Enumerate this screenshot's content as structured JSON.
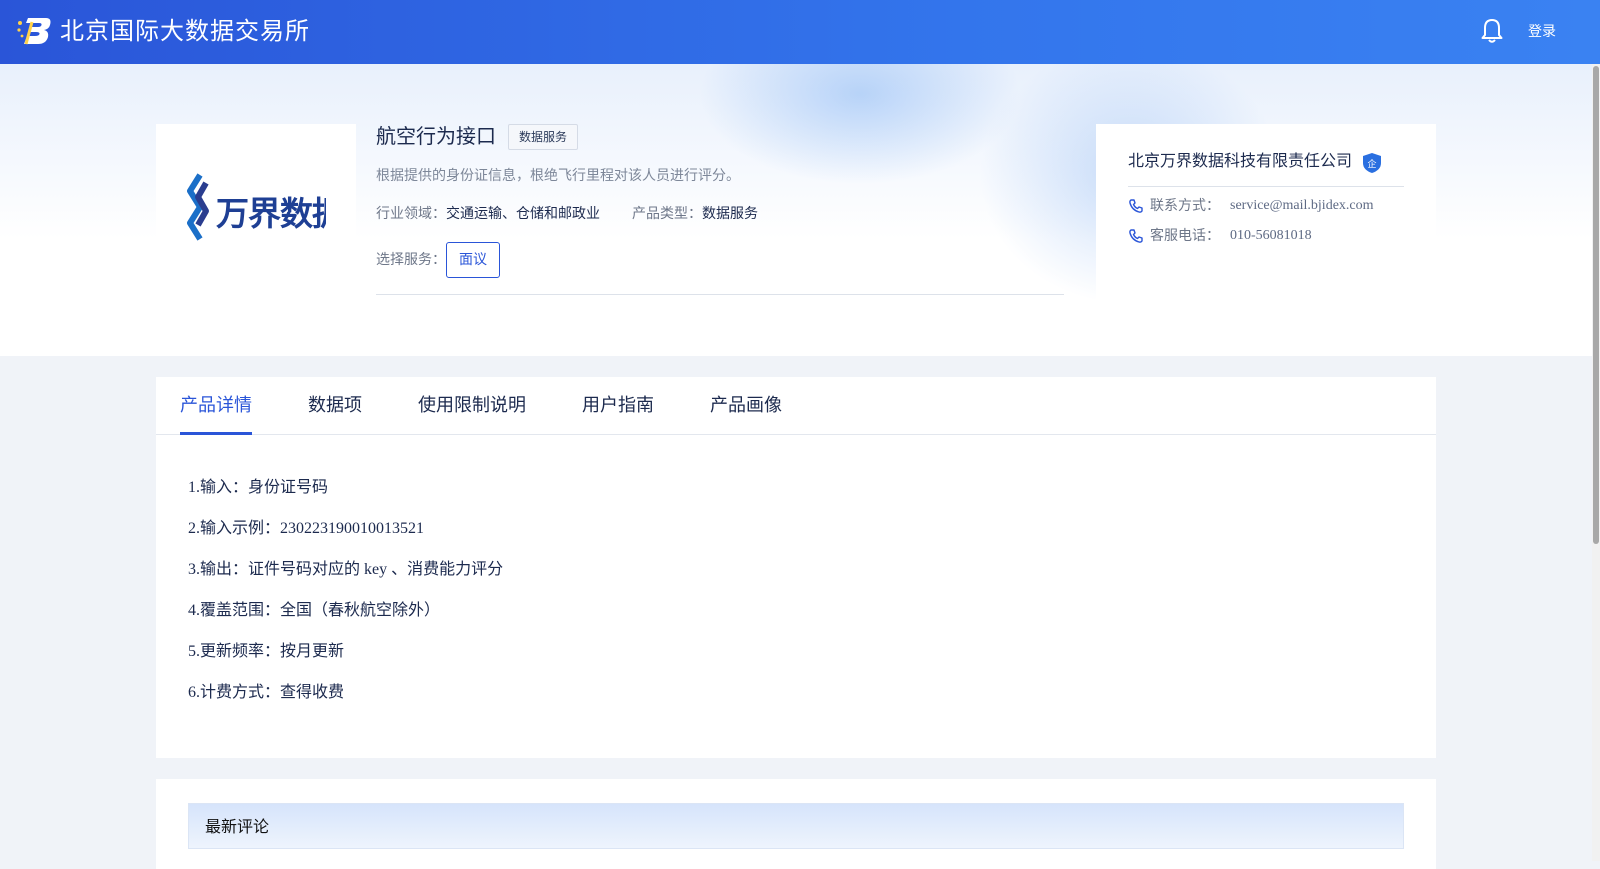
{
  "header": {
    "site_title": "北京国际大数据交易所",
    "login_label": "登录"
  },
  "product": {
    "name": "航空行为接口",
    "type_tag": "数据服务",
    "description": "根据提供的身份证信息，根绝飞行里程对该人员进行评分。",
    "industry_label": "行业领域：",
    "industry_value": "交通运输、仓储和邮政业",
    "product_type_label": "产品类型：",
    "product_type_value": "数据服务",
    "service_label": "选择服务：",
    "service_option": "面议"
  },
  "company": {
    "name": "北京万界数据科技有限责任公司",
    "badge_text": "企",
    "contact_label": "联系方式：",
    "contact_value": "service@mail.bjidex.com",
    "phone_label": "客服电话：",
    "phone_value": "010-56081018"
  },
  "tabs": [
    {
      "label": "产品详情",
      "active": true
    },
    {
      "label": "数据项",
      "active": false
    },
    {
      "label": "使用限制说明",
      "active": false
    },
    {
      "label": "用户指南",
      "active": false
    },
    {
      "label": "产品画像",
      "active": false
    }
  ],
  "details": [
    "1.输入：身份证号码",
    "2.输入示例：230223190010013521",
    "3.输出：证件号码对应的 key 、消费能力评分",
    "4.覆盖范围：全国（春秋航空除外）",
    "5.更新频率：按月更新",
    "6.计费方式：查得收费"
  ],
  "comments": {
    "title": "最新评论"
  },
  "colors": {
    "accent": "#2a55d8",
    "header_start": "#2a55d8",
    "header_end": "#3a82f2",
    "text_dark": "#1c2a4e"
  },
  "icons": {
    "logo": "bjidex-logo-icon",
    "bell": "bell-icon",
    "badge": "enterprise-shield-icon",
    "phone": "phone-icon"
  }
}
